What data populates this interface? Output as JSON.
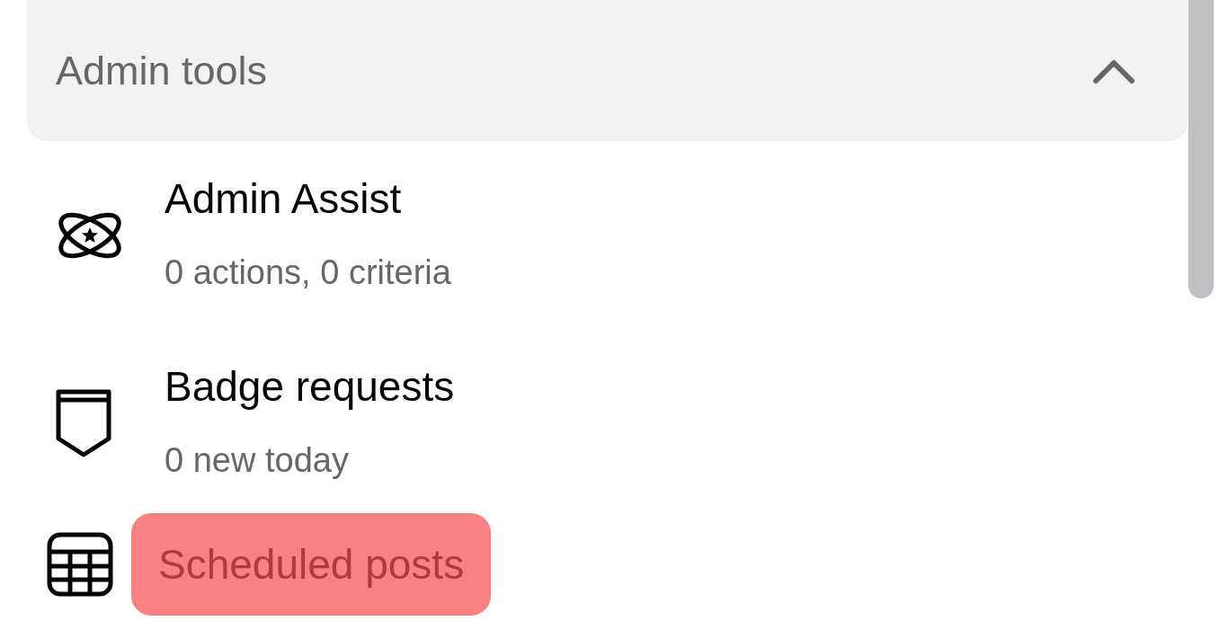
{
  "section": {
    "title": "Admin tools",
    "expanded": true
  },
  "items": [
    {
      "kind": "tool",
      "title": "Admin Assist",
      "subtitle": "0 actions, 0 criteria"
    },
    {
      "kind": "tool",
      "title": "Badge requests",
      "subtitle": "0 new today"
    },
    {
      "kind": "link",
      "title": "Scheduled posts",
      "highlighted": true
    }
  ]
}
